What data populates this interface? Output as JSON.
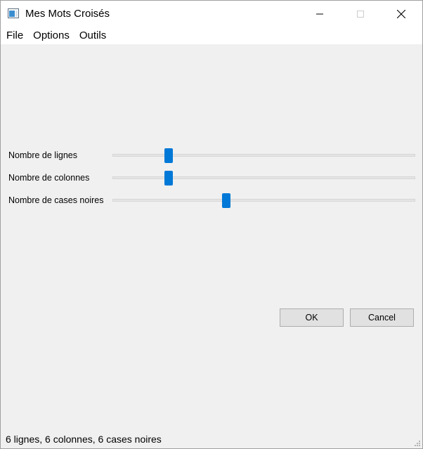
{
  "window": {
    "title": "Mes Mots Croisés"
  },
  "menu": {
    "items": [
      "File",
      "Options",
      "Outils"
    ]
  },
  "sliders": [
    {
      "label": "Nombre de lignes",
      "value_fraction": 0.186
    },
    {
      "label": "Nombre de colonnes",
      "value_fraction": 0.186
    },
    {
      "label": "Nombre de cases noires",
      "value_fraction": 0.376
    }
  ],
  "buttons": {
    "ok_label": "OK",
    "cancel_label": "Cancel"
  },
  "status": {
    "text": "6 lignes, 6 colonnes, 6 cases noires"
  },
  "colors": {
    "accent": "#0078d7",
    "background": "#f0f0f0"
  },
  "icons": {
    "app": "app-window-icon",
    "minimize": "minimize-icon",
    "maximize": "maximize-icon",
    "close": "close-icon",
    "grip": "size-grip-icon"
  }
}
